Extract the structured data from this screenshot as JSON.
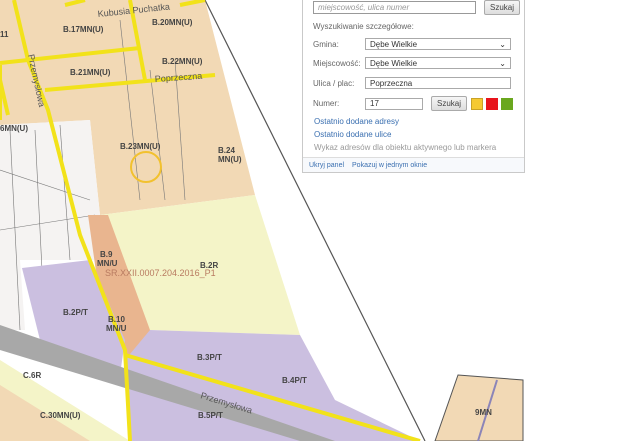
{
  "map": {
    "zone_labels": [
      "B.17MN(U)",
      "B.20MN(U)",
      "B.22MN(U)",
      "B.21MN(U)",
      "B.23MN(U)",
      "B.24",
      "MN(U)",
      "6MN(U)",
      "11",
      "B.9",
      "MN/U",
      "B.2R",
      "B.2P/T",
      "B.10",
      "MN/U",
      "B.3P/T",
      "B.4P/T",
      "B.5P/T",
      "C.6R",
      "C.30MN(U)",
      "9MN"
    ],
    "streets": [
      "Kubusia Puchatka",
      "Poprzeczna",
      "Przemysłowa",
      "Przemysłowa"
    ],
    "annotation": "SR.XXII.0007.204.2016_P1",
    "colors": {
      "residential": "#f2d9b5",
      "agricultural": "#f4f4c8",
      "industrial": "#cbbfe0",
      "road": "#f2e21a",
      "rail": "#a8a8a8",
      "marker": "#f2c12e"
    }
  },
  "panel": {
    "search_placeholder": "miejscowość, ulica numer",
    "search_button": "Szukaj",
    "detail_heading": "Wyszukiwanie szczegółowe:",
    "gmina_label": "Gmina:",
    "gmina_value": "Dębe Wielkie",
    "miejscowosc_label": "Miejscowość:",
    "miejscowosc_value": "Dębe Wielkie",
    "ulica_label": "Ulica / plac:",
    "ulica_value": "Poprzeczna",
    "numer_label": "Numer:",
    "numer_value": "17",
    "numer_button": "Szukaj",
    "marker_colors": [
      "#f5c932",
      "#e8141c",
      "#6aa71e"
    ],
    "links": [
      "Ostatnio dodane adresy",
      "Ostatnio dodane ulice"
    ],
    "disabled_link": "Wykaz adresów dla obiektu aktywnego lub markera",
    "footer_links": [
      "Ukryj panel",
      "Pokazuj w jednym oknie"
    ]
  }
}
